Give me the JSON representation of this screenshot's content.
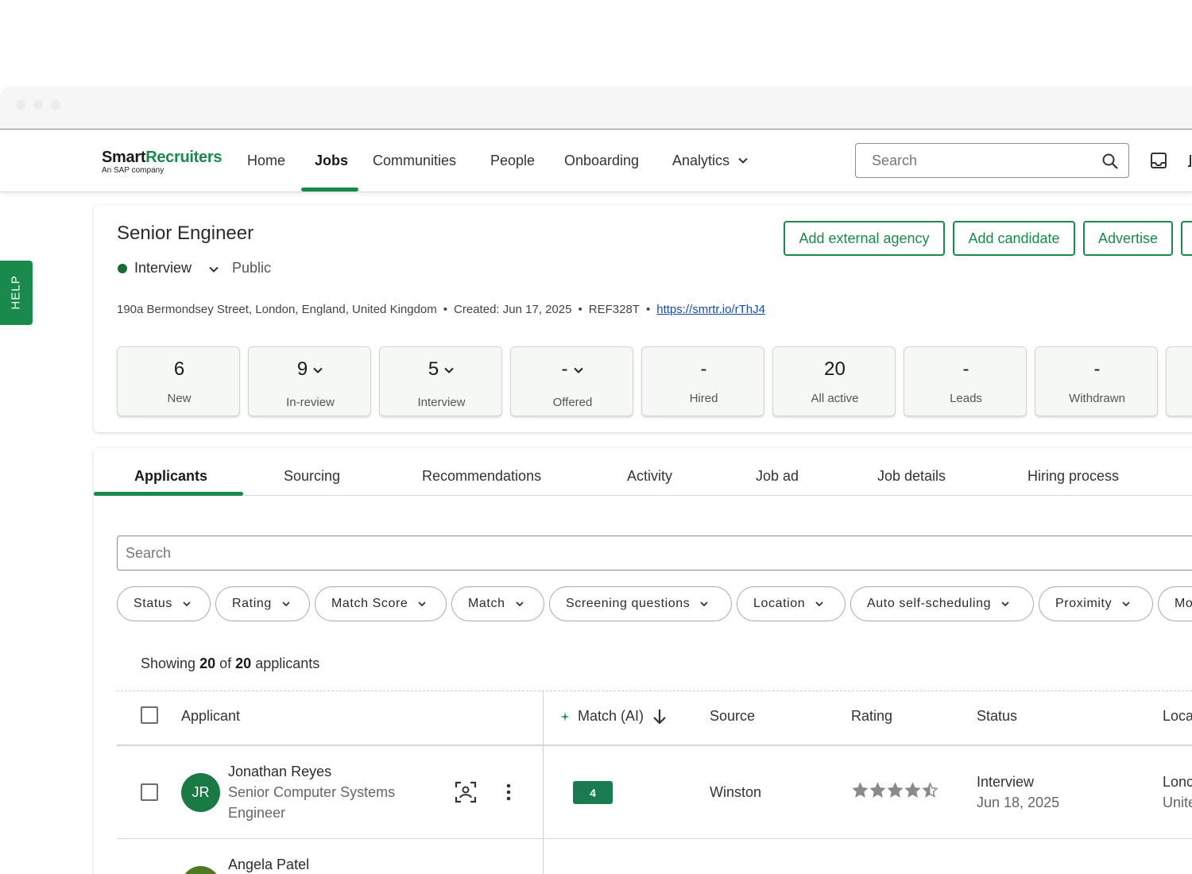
{
  "logo": {
    "part1": "Smart",
    "part2": "Recruiters",
    "sub": "An SAP company"
  },
  "nav": {
    "items": [
      {
        "label": "Home"
      },
      {
        "label": "Jobs"
      },
      {
        "label": "Communities"
      },
      {
        "label": "People"
      },
      {
        "label": "Onboarding"
      },
      {
        "label": "Analytics"
      }
    ],
    "active": "Jobs",
    "search_placeholder": "Search"
  },
  "help": {
    "label": "HELP"
  },
  "job": {
    "title": "Senior Engineer",
    "status": "Interview",
    "visibility": "Public",
    "address": "190a Bermondsey Street, London, England, United Kingdom",
    "created": "Created: Jun 17, 2025",
    "ref": "REF328T",
    "link": "https://smrtr.io/rThJ4",
    "separator": "•",
    "status_color": "#1a6b34"
  },
  "actions": {
    "add_agency": "Add external agency",
    "add_candidate": "Add candidate",
    "advertise": "Advertise"
  },
  "stats": [
    {
      "value": "6",
      "label": "New"
    },
    {
      "value": "9",
      "label": "In-review"
    },
    {
      "value": "5",
      "label": "Interview"
    },
    {
      "value": "-",
      "label": "Offered"
    },
    {
      "value": "-",
      "label": "Hired"
    },
    {
      "value": "20",
      "label": "All active"
    },
    {
      "value": "-",
      "label": "Leads"
    },
    {
      "value": "-",
      "label": "Withdrawn"
    }
  ],
  "tabs": [
    {
      "label": "Applicants"
    },
    {
      "label": "Sourcing"
    },
    {
      "label": "Recommendations"
    },
    {
      "label": "Activity"
    },
    {
      "label": "Job ad"
    },
    {
      "label": "Job details"
    },
    {
      "label": "Hiring process"
    }
  ],
  "applicant_search_placeholder": "Search",
  "filters": [
    {
      "label": "Status"
    },
    {
      "label": "Rating"
    },
    {
      "label": "Match Score"
    },
    {
      "label": "Match"
    },
    {
      "label": "Screening questions"
    },
    {
      "label": "Location"
    },
    {
      "label": "Auto self-scheduling"
    },
    {
      "label": "Proximity"
    },
    {
      "label": "Mo"
    }
  ],
  "showing": {
    "prefix": "Showing",
    "count": "20",
    "of": "of",
    "total": "20",
    "suffix": "applicants"
  },
  "table": {
    "headers": {
      "applicant": "Applicant",
      "match": "Match (AI)",
      "source": "Source",
      "rating": "Rating",
      "status": "Status",
      "location": "Loca"
    },
    "rows": [
      {
        "initials": "JR",
        "name": "Jonathan Reyes",
        "title_line1": "Senior Computer Systems",
        "title_line2": "Engineer",
        "match": "4",
        "source": "Winston",
        "rating": 4.5,
        "status": "Interview",
        "status_date": "Jun 18, 2025",
        "location_line1": "Lonc",
        "location_line2": "Unite"
      },
      {
        "name": "Angela Patel"
      }
    ]
  },
  "colors": {
    "brand_green": "#1a8a4c",
    "badge_green": "#1a7a50"
  }
}
